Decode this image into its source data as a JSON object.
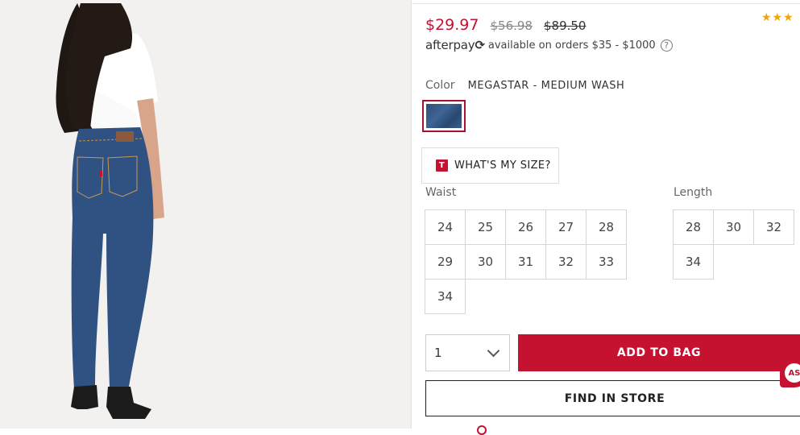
{
  "product": {
    "price_sale": "$29.97",
    "price_was_1": "$56.98",
    "price_was_2": "$89.50",
    "stars": "★★★",
    "rating_color": "#f0a30a"
  },
  "afterpay": {
    "logo_text": "afterpay",
    "logo_mark": "⟳",
    "note": "available on orders $35 - $1000",
    "help": "?"
  },
  "color": {
    "label": "Color",
    "value": "MEGASTAR - MEDIUM WASH"
  },
  "size_help": {
    "icon_letter": "T",
    "label": "WHAT'S MY SIZE?"
  },
  "waist": {
    "label": "Waist",
    "sizes": [
      "24",
      "25",
      "26",
      "27",
      "28",
      "29",
      "30",
      "31",
      "32",
      "33",
      "34"
    ]
  },
  "length": {
    "label": "Length",
    "sizes": [
      "28",
      "30",
      "32",
      "34"
    ]
  },
  "quantity": {
    "value": "1"
  },
  "actions": {
    "add_to_bag": "ADD TO BAG",
    "find_in_store": "FIND IN STORE"
  },
  "chat": {
    "label": "AS"
  },
  "colors": {
    "accent": "#c41230",
    "text": "#333333"
  }
}
